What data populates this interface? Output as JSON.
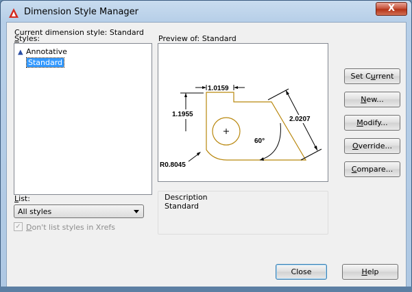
{
  "window": {
    "title": "Dimension Style Manager",
    "close_symbol": "X"
  },
  "current_style": {
    "label": "Current dimension style: Standard"
  },
  "styles": {
    "label_prefix": "",
    "label_accel": "S",
    "label_rest": "tyles:",
    "items": [
      {
        "label": "Annotative",
        "icon": "annotative-icon"
      },
      {
        "label": "Standard",
        "selected": true
      }
    ]
  },
  "preview": {
    "label": "Preview of: Standard",
    "dims": {
      "top": "1.0159",
      "left": "1.1955",
      "slant": "2.0207",
      "angle": "60°",
      "radius": "R0.8045"
    },
    "line_color": "#b8860b"
  },
  "list": {
    "label_accel": "L",
    "label_rest": "ist:",
    "selected": "All styles"
  },
  "xrefs_checkbox": {
    "checked": true,
    "label_accel": "D",
    "label_rest": "on't list styles in Xrefs"
  },
  "description": {
    "title": "Description",
    "text": "Standard"
  },
  "buttons": {
    "set_current_pre": "Set C",
    "set_current_accel": "u",
    "set_current_post": "rrent",
    "new_accel": "N",
    "new_rest": "ew...",
    "modify_accel": "M",
    "modify_rest": "odify...",
    "override_accel": "O",
    "override_rest": "verride...",
    "compare_accel": "C",
    "compare_rest": "ompare...",
    "close": "Close",
    "help_accel": "H",
    "help_rest": "elp"
  }
}
